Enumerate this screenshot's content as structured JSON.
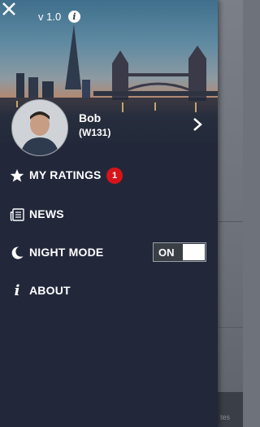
{
  "app": {
    "version": "v 1.0"
  },
  "profile": {
    "name": "Bob",
    "id": "(W131)"
  },
  "menu": [
    {
      "key": "ratings",
      "label": "MY RATINGS",
      "icon": "star-icon",
      "badge": "1"
    },
    {
      "key": "news",
      "label": "NEWS",
      "icon": "news-icon"
    },
    {
      "key": "night",
      "label": "NIGHT MODE",
      "icon": "moon-icon",
      "toggle": "ON"
    },
    {
      "key": "about",
      "label": "ABOUT",
      "icon": "info-italic-icon"
    }
  ],
  "backdrop": {
    "footer_text": "tes"
  },
  "colors": {
    "drawer_bg": "#22283a",
    "badge": "#d7141a",
    "toggle_bg": "#3a3e45"
  }
}
